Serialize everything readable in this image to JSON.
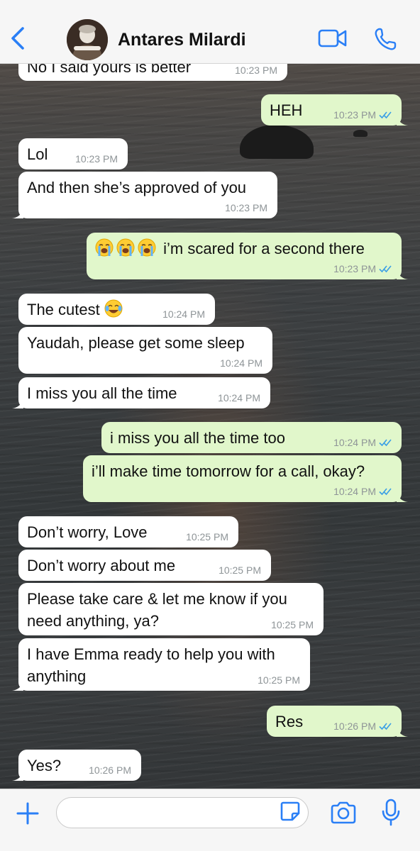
{
  "header": {
    "back_icon": "chevron-left-icon",
    "contact_name": "Antares Milardi",
    "video_icon": "video-camera-icon",
    "call_icon": "phone-icon"
  },
  "colors": {
    "accent": "#2a7ff6",
    "incoming_bubble": "#ffffff",
    "outgoing_bubble": "#e1f7cb",
    "read_ticks": "#3a9fe6",
    "timestamp": "#8e9497"
  },
  "messages": [
    {
      "direction": "in",
      "text": "No I said yours is better",
      "time": "10:23 PM"
    },
    {
      "direction": "out",
      "text": "HEH",
      "time": "10:23 PM",
      "status": "read"
    },
    {
      "direction": "in",
      "text": "Lol",
      "time": "10:23 PM"
    },
    {
      "direction": "in",
      "text": "And then she’s approved of you",
      "time": "10:23 PM"
    },
    {
      "direction": "out",
      "text": "😭😭😭 i’m scared for a second there",
      "emojis": [
        "loudly-crying-face",
        "loudly-crying-face",
        "loudly-crying-face"
      ],
      "emoji_text": "i’m scared for a second there",
      "time": "10:23 PM",
      "status": "read"
    },
    {
      "direction": "in",
      "text": "The cutest 😂",
      "emojis": [
        "face-with-tears-of-joy"
      ],
      "emoji_text": "The cutest",
      "time": "10:24 PM"
    },
    {
      "direction": "in",
      "text": "Yaudah, please get some sleep",
      "time": "10:24 PM"
    },
    {
      "direction": "in",
      "text": "I miss you all the time",
      "time": "10:24 PM"
    },
    {
      "direction": "out",
      "text": "i miss you all the time too",
      "time": "10:24 PM",
      "status": "read"
    },
    {
      "direction": "out",
      "text": "i’ll make time tomorrow for a call, okay?",
      "time": "10:24 PM",
      "status": "read"
    },
    {
      "direction": "in",
      "text": "Don’t worry, Love",
      "time": "10:25 PM"
    },
    {
      "direction": "in",
      "text": "Don’t worry about me",
      "time": "10:25 PM"
    },
    {
      "direction": "in",
      "lines": [
        "Please take care & let me know if you",
        "need anything, ya?"
      ],
      "time": "10:25 PM"
    },
    {
      "direction": "in",
      "lines": [
        "I have Emma ready to help you with",
        "anything"
      ],
      "time": "10:25 PM"
    },
    {
      "direction": "out",
      "text": "Res",
      "time": "10:26 PM",
      "status": "read"
    },
    {
      "direction": "in",
      "text": "Yes?",
      "time": "10:26 PM"
    }
  ],
  "composer": {
    "plus_icon": "plus-icon",
    "input_value": "",
    "sticker_icon": "sticker-icon",
    "camera_icon": "camera-icon",
    "mic_icon": "microphone-icon"
  }
}
